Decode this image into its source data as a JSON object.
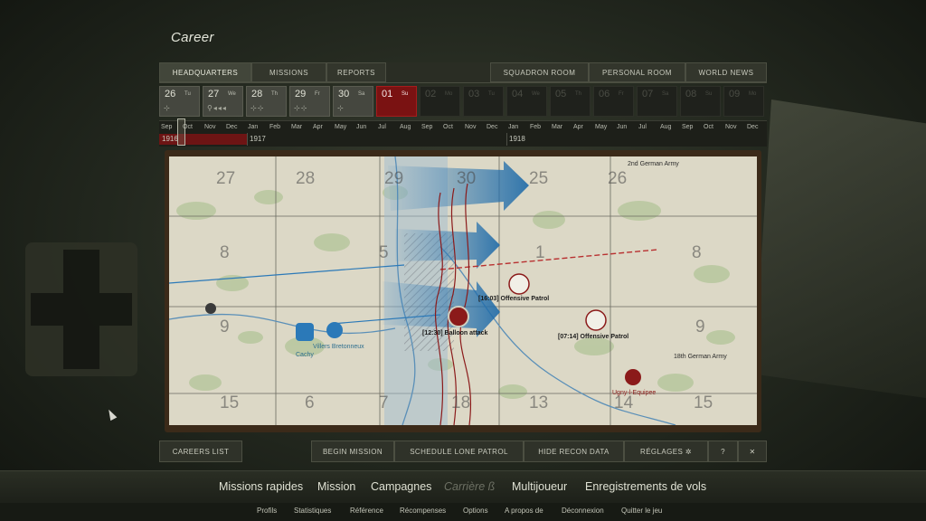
{
  "page": {
    "title": "Career"
  },
  "tabs_left": [
    "HEADQUARTERS",
    "MISSIONS",
    "REPORTS"
  ],
  "tabs_right": [
    "SQUADRON ROOM",
    "PERSONAL ROOM",
    "WORLD NEWS"
  ],
  "days": [
    {
      "num": "26",
      "dow": "Tu",
      "icons": "⊹"
    },
    {
      "num": "27",
      "dow": "We",
      "icons": "⚲◂◂◂"
    },
    {
      "num": "28",
      "dow": "Th",
      "icons": "⊹⊹"
    },
    {
      "num": "29",
      "dow": "Fr",
      "icons": "⊹⊹"
    },
    {
      "num": "30",
      "dow": "Sa",
      "icons": "⊹"
    },
    {
      "num": "01",
      "dow": "Su",
      "icons": ""
    },
    {
      "num": "02",
      "dow": "Mo",
      "icons": ""
    },
    {
      "num": "03",
      "dow": "Tu",
      "icons": ""
    },
    {
      "num": "04",
      "dow": "We",
      "icons": ""
    },
    {
      "num": "05",
      "dow": "Th",
      "icons": ""
    },
    {
      "num": "06",
      "dow": "Fr",
      "icons": ""
    },
    {
      "num": "07",
      "dow": "Sa",
      "icons": ""
    },
    {
      "num": "08",
      "dow": "Su",
      "icons": ""
    },
    {
      "num": "09",
      "dow": "Mo",
      "icons": ""
    }
  ],
  "selected_day_index": 5,
  "months": [
    "Sep",
    "Oct",
    "Nov",
    "Dec",
    "Jan",
    "Feb",
    "Mar",
    "Apr",
    "May",
    "Jun",
    "Jul",
    "Aug",
    "Sep",
    "Oct",
    "Nov",
    "Dec",
    "Jan",
    "Feb",
    "Mar",
    "Apr",
    "May",
    "Jun",
    "Jul",
    "Aug",
    "Sep",
    "Oct",
    "Nov",
    "Dec"
  ],
  "years": [
    "1916",
    "1917",
    "1918"
  ],
  "map": {
    "grid_numbers": [
      "27",
      "28",
      "29",
      "30",
      "25",
      "26",
      "8",
      "5",
      "1",
      "8",
      "9",
      "9",
      "15",
      "6",
      "7",
      "18",
      "13",
      "14",
      "15"
    ],
    "missions": [
      {
        "time": "[16:03]",
        "name": "Offensive Patrol"
      },
      {
        "time": "[12:30]",
        "name": "Balloon attack"
      },
      {
        "time": "[07:14]",
        "name": "Offensive Patrol"
      }
    ],
    "armies": [
      "2nd German Army",
      "18th German Army"
    ],
    "airfields": {
      "blue1": "Villers Bretonneux",
      "blue2": "Cachy",
      "red": "Ugny-l-Equipee"
    }
  },
  "bottom_buttons": [
    "CAREERS LIST",
    "BEGIN MISSION",
    "SCHEDULE LONE PATROL",
    "HIDE RECON DATA",
    "RÉGLAGES",
    "?",
    "✕"
  ],
  "main_menu": [
    "Missions rapides",
    "Mission",
    "Campagnes",
    "Carrière ß",
    "Multijoueur",
    "Enregistrements de vols"
  ],
  "sub_menu": [
    "Profils",
    "Statistiques",
    "Référence",
    "Récompenses",
    "Options",
    "A propos de",
    "Déconnexion",
    "Quitter le jeu"
  ],
  "colors": {
    "selected_day": "#7a1212",
    "allied_blue": "#2b79b8",
    "enemy_red": "#8b1a1a"
  }
}
